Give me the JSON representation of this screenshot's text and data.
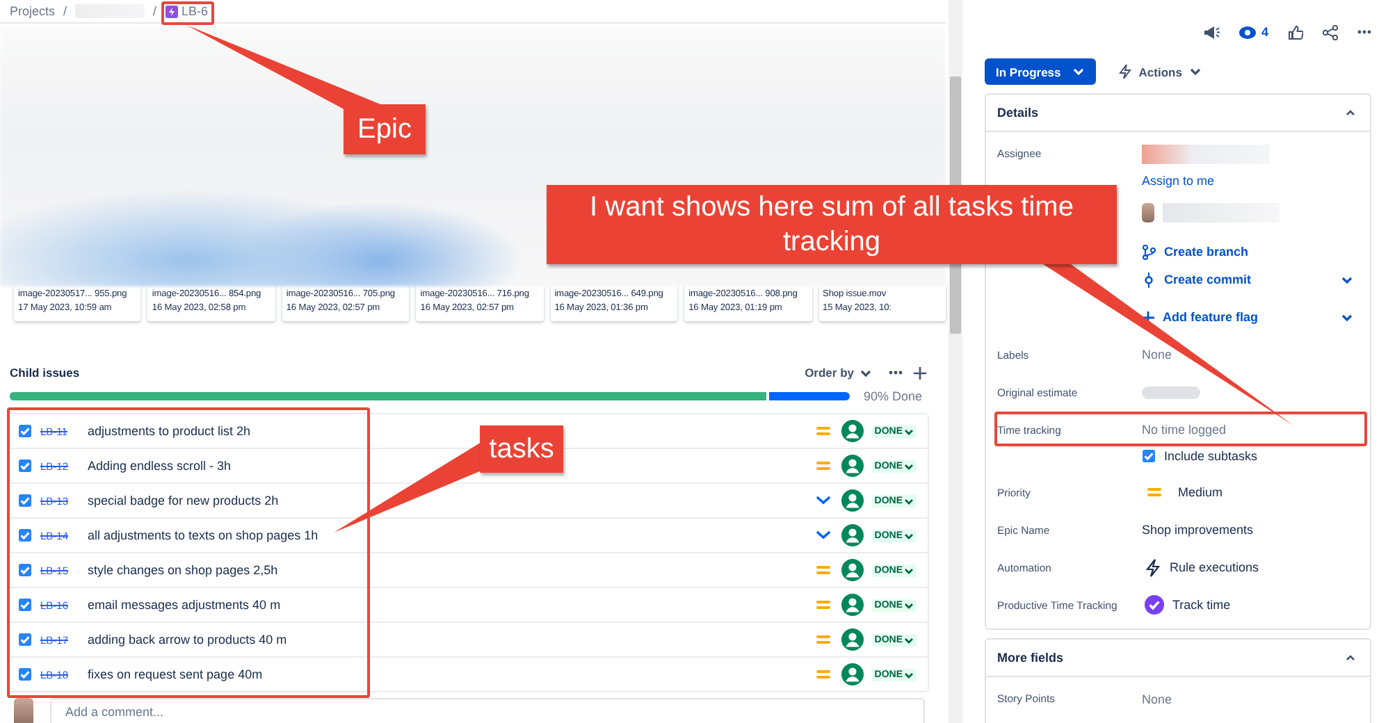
{
  "breadcrumb": [
    {
      "kind": "link",
      "label": "Projects"
    },
    {
      "kind": "sep",
      "label": "/"
    },
    {
      "kind": "blurred"
    },
    {
      "kind": "sep",
      "label": "/"
    },
    {
      "kind": "epic",
      "label": "LB-6"
    }
  ],
  "attachments": [
    {
      "name": "image-20230517... 955.png",
      "date": "17 May 2023, 10:59 am"
    },
    {
      "name": "image-20230516... 854.png",
      "date": "16 May 2023, 02:58 pm"
    },
    {
      "name": "image-20230516... 705.png",
      "date": "16 May 2023, 02:57 pm"
    },
    {
      "name": "image-20230516... 716.png",
      "date": "16 May 2023, 02:57 pm"
    },
    {
      "name": "image-20230516... 649.png",
      "date": "16 May 2023, 01:36 pm"
    },
    {
      "name": "image-20230516... 908.png",
      "date": "16 May 2023, 01:19 pm"
    },
    {
      "name": "Shop issue.mov",
      "date": "15 May 2023, 10:"
    }
  ],
  "child_issues": {
    "title": "Child issues",
    "order_by": "Order by",
    "progress": {
      "level": 0.9,
      "label": "90% Done"
    },
    "issues": [
      {
        "key": "LB-11",
        "summary": "adjustments to product list 2h",
        "checked": true,
        "done": true,
        "kind": "medium",
        "status": "DONE"
      },
      {
        "key": "LB-12",
        "summary": "Adding endless scroll - 3h",
        "checked": true,
        "done": true,
        "kind": "medium",
        "status": "DONE"
      },
      {
        "key": "LB-13",
        "summary": "special badge for new products 2h",
        "checked": true,
        "done": true,
        "kind": "low",
        "status": "DONE"
      },
      {
        "key": "LB-14",
        "summary": "all adjustments to texts on shop pages 1h",
        "checked": true,
        "done": true,
        "kind": "low",
        "status": "DONE"
      },
      {
        "key": "LB-15",
        "summary": "style changes on shop pages 2,5h",
        "checked": true,
        "done": true,
        "kind": "medium",
        "status": "DONE"
      },
      {
        "key": "LB-16",
        "summary": "email messages adjustments 40 m",
        "checked": true,
        "done": true,
        "kind": "medium",
        "status": "DONE"
      },
      {
        "key": "LB-17",
        "summary": "adding back arrow to products 40 m",
        "checked": true,
        "done": true,
        "kind": "medium",
        "status": "DONE"
      },
      {
        "key": "LB-18",
        "summary": "fixes on request sent page 40m",
        "checked": true,
        "done": true,
        "kind": "medium",
        "status": "DONE"
      }
    ]
  },
  "comment": {
    "placeholder": "Add a comment..."
  },
  "toolbar": {
    "watchers": "4"
  },
  "status_button": "In Progress",
  "actions": "Actions",
  "details": {
    "title": "Details",
    "expanded": true,
    "fields": [
      {
        "kind": "blurred",
        "label": "Assignee",
        "link": "Assign to me"
      },
      {
        "kind": "avatar-blurred"
      },
      {
        "kind": "branch",
        "value": "Create branch",
        "dropdown": false
      },
      {
        "kind": "commit",
        "value": "Create commit",
        "dropdown": true
      },
      {
        "kind": "flag",
        "value": "Add feature flag",
        "dropdown": true
      },
      {
        "kind": "text",
        "label": "Labels",
        "value": "None",
        "empty": true
      },
      {
        "kind": "blurred-pill",
        "label": "Original estimate"
      },
      {
        "kind": "time",
        "label": "Time tracking",
        "value": "No time logged",
        "include": {
          "label": "Include subtasks",
          "checked": true
        }
      },
      {
        "kind": "priority",
        "label": "Priority",
        "value": "Medium"
      },
      {
        "kind": "text",
        "label": "Epic Name",
        "value": "Shop improvements",
        "empty": false
      },
      {
        "kind": "automation",
        "label": "Automation",
        "value": "Rule executions"
      },
      {
        "kind": "tracker",
        "label": "Productive Time Tracking",
        "value": "Track time"
      }
    ]
  },
  "more_fields": {
    "title": "More fields",
    "expanded": true,
    "fields": [
      {
        "kind": "text",
        "label": "Story Points",
        "value": "None",
        "empty": true
      }
    ]
  },
  "annotations": [
    {
      "kind": "epic",
      "text": "Epic"
    },
    {
      "kind": "time",
      "text": "I want shows here sum of all tasks time tracking"
    },
    {
      "kind": "tasks",
      "text": "tasks"
    }
  ]
}
